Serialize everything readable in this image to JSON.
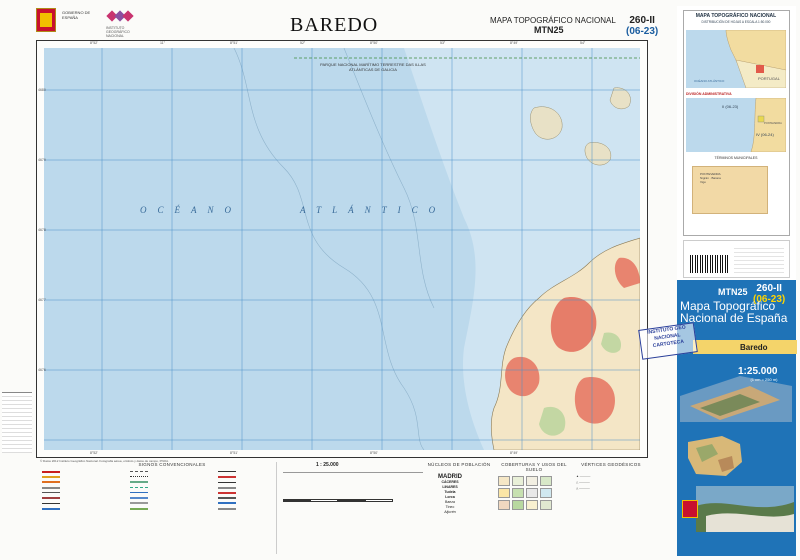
{
  "header": {
    "ministry": "GOBIERNO DE ESPAÑA",
    "ministry_sub": "MINISTERIO DE TRANSPORTES, MOVILIDAD Y AGENDA URBANA",
    "ign": "INSTITUTO GEOGRÁFICO NACIONAL",
    "map_title": "BAREDO",
    "series": "MAPA TOPOGRÁFICO NACIONAL",
    "mtn": "MTN25",
    "sheet": "260-II",
    "sheet_grid": "(06-23)"
  },
  "map": {
    "ocean_word1": "OCÉANO",
    "ocean_word2": "ATLÁNTICO",
    "park_label": "PARQUE NACIONAL MARÍTIMO TERRESTRE DAS ILLAS ATLÁNTICAS DE GALICIA",
    "top_ticks": [
      "8°52'",
      "11°",
      "8°51'",
      "52°",
      "8°50'",
      "53°",
      "8°49'",
      "54°",
      "8°48'",
      "55°"
    ],
    "left_ticks": [
      "4680",
      "4679",
      "4678",
      "4677",
      "4676",
      "4675",
      "4674",
      "4673",
      "4672",
      "4671"
    ],
    "credits": "© Datos 2012 Instituto Geográfico Nacional. Fotografía aérea, ortofoto y datos de campo, PNOA."
  },
  "legend": {
    "signs_title": "SIGNOS CONVENCIONALES",
    "scale": "1 : 25.000",
    "population_title": "NÚCLEOS DE POBLACIÓN",
    "landcover_title": "COBERTURAS Y USOS DEL SUELO",
    "geodetic_title": "VÉRTICES GEODÉSICOS",
    "madrid": "MADRID",
    "population_examples": [
      "CÁCERES",
      "LINARES",
      "Tudela",
      "Lorca",
      "Baeza",
      "Tineo",
      "Aljucén"
    ]
  },
  "side_panel": {
    "index_title": "MAPA TOPOGRÁFICO NACIONAL",
    "index_sub": "DISTRIBUCIÓN DE HOJAS A ESCALA 1:50.000",
    "admin_title": "DIVISIÓN ADMINISTRATIVA",
    "terms_title": "TÉRMINOS MUNICIPALES",
    "terms_text": "PONTEVEDRA\nNigrán · Baiona\nVigo",
    "index_labels": [
      "PORTUGAL",
      "OCÉANO ATLÁNTICO",
      "II (06-23)",
      "IV (06-24)",
      "PONTEVEDRA"
    ],
    "cover_mtn": "MTN25",
    "cover_sheet": "260-II",
    "cover_grid": "(06-23)",
    "cover_title": "Mapa Topográfico Nacional de España",
    "cover_name": "Baredo",
    "cover_scale": "1:25.000",
    "cover_scale_note": "(1 cm = 250 m)",
    "stamp": "INSTITUTO GEO NACIONAL CARTOTECA"
  },
  "colors": {
    "sea": "#bcd9ec",
    "sea_shallow": "#cfe4f2",
    "land": "#f4e6c6",
    "urban": "#e25a4a",
    "cover_blue": "#1f73b7",
    "grid": "#4a90c8"
  }
}
